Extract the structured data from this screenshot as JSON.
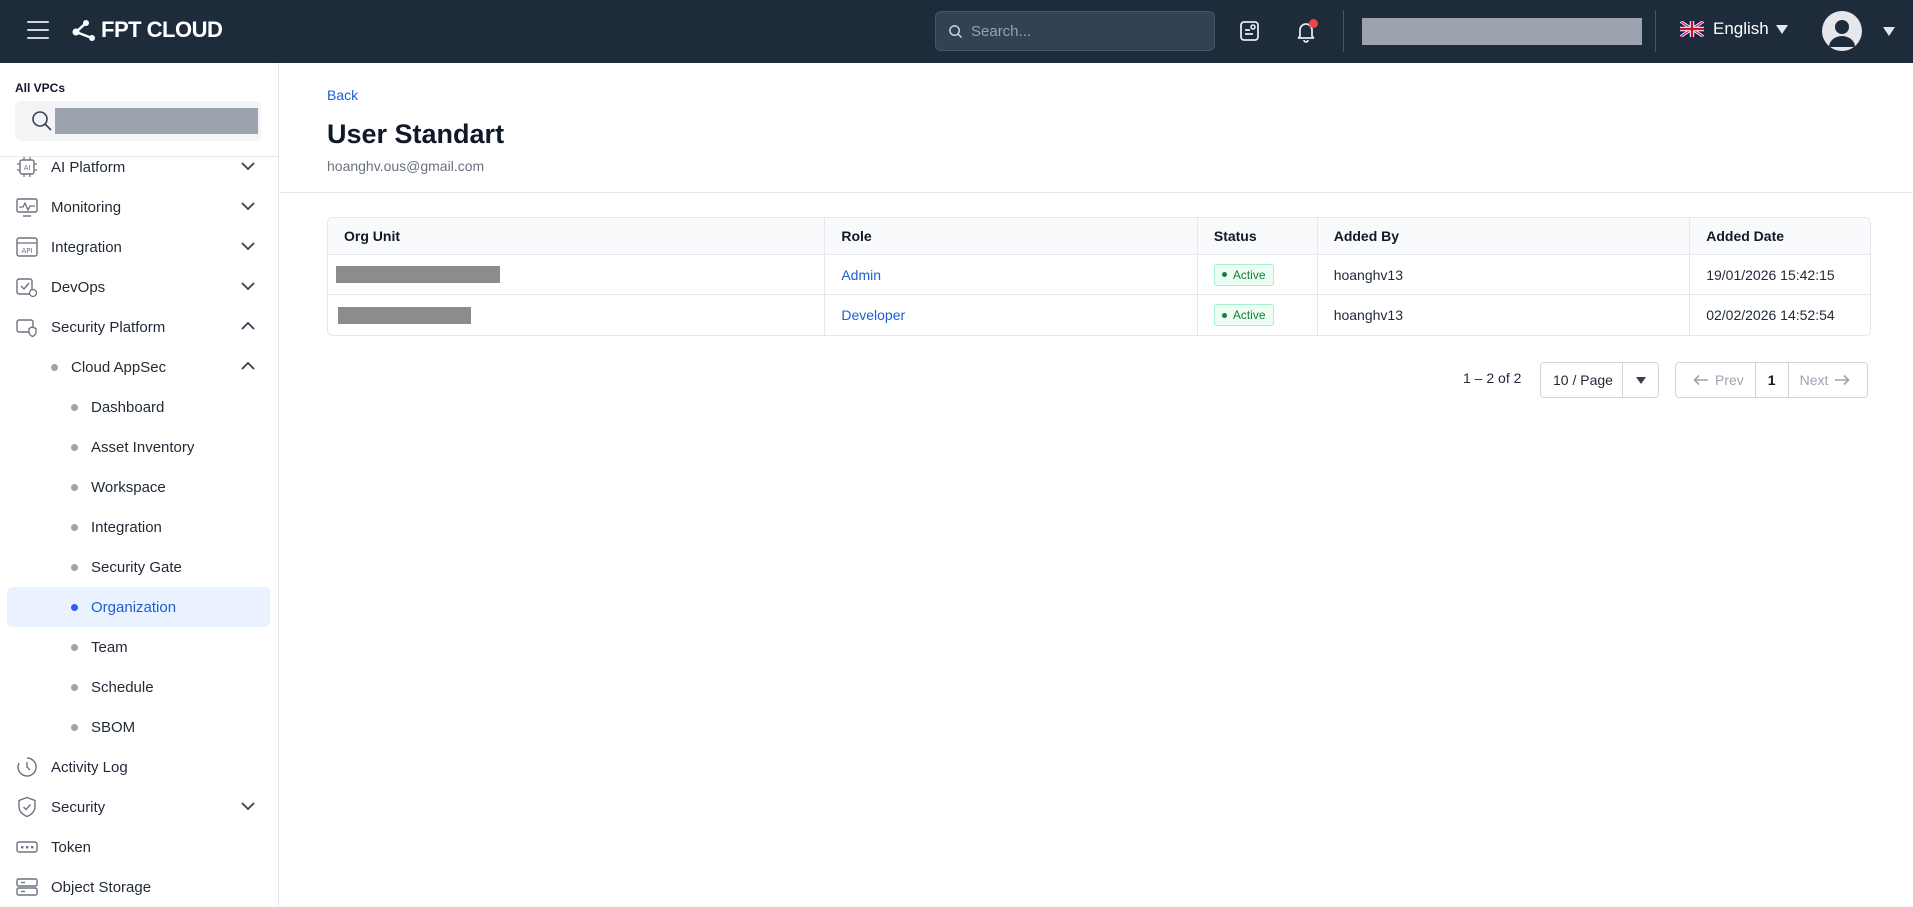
{
  "header": {
    "brand": "FPT CLOUD",
    "search_placeholder": "Search...",
    "language": "English",
    "icons": [
      "menu-icon",
      "fpt-logo",
      "search-icon",
      "tasks-icon",
      "bell-icon",
      "uk-flag-icon",
      "user-avatar-icon",
      "caret-down-icon"
    ]
  },
  "sidebar": {
    "vpc_label": "All VPCs",
    "items": [
      {
        "label": "AI Platform",
        "icon": "ai-chip-icon",
        "expandable": true,
        "expanded": false
      },
      {
        "label": "Monitoring",
        "icon": "monitor-icon",
        "expandable": true,
        "expanded": false
      },
      {
        "label": "Integration",
        "icon": "api-icon",
        "expandable": true,
        "expanded": false
      },
      {
        "label": "DevOps",
        "icon": "devops-icon",
        "expandable": true,
        "expanded": false
      },
      {
        "label": "Security Platform",
        "icon": "security-platform-icon",
        "expandable": true,
        "expanded": true
      },
      {
        "label": "Cloud AppSec",
        "level": 2,
        "expandable": true,
        "expanded": true
      },
      {
        "label": "Dashboard",
        "level": 3
      },
      {
        "label": "Asset Inventory",
        "level": 3
      },
      {
        "label": "Workspace",
        "level": 3
      },
      {
        "label": "Integration",
        "level": 3
      },
      {
        "label": "Security Gate",
        "level": 3
      },
      {
        "label": "Organization",
        "level": 3,
        "active": true
      },
      {
        "label": "Team",
        "level": 3
      },
      {
        "label": "Schedule",
        "level": 3
      },
      {
        "label": "SBOM",
        "level": 3
      },
      {
        "label": "Activity Log",
        "icon": "clock-icon"
      },
      {
        "label": "Security",
        "icon": "shield-icon",
        "expandable": true,
        "expanded": false
      },
      {
        "label": "Token",
        "icon": "token-icon"
      },
      {
        "label": "Object Storage",
        "icon": "storage-icon"
      }
    ]
  },
  "main": {
    "back_label": "Back",
    "title": "User Standart",
    "email": "hoanghv.ous@gmail.com",
    "table": {
      "columns": [
        "Org Unit",
        "Role",
        "Status",
        "Added By",
        "Added Date"
      ],
      "rows": [
        {
          "org_unit": "",
          "role": "Admin",
          "status": "Active",
          "added_by": "hoanghv13",
          "added_date": "19/01/2026 15:42:15"
        },
        {
          "org_unit": "",
          "role": "Developer",
          "status": "Active",
          "added_by": "hoanghv13",
          "added_date": "02/02/2026 14:52:54"
        }
      ]
    },
    "pagination": {
      "total_text": "1 – 2 of 2",
      "page_size": "10 / Page",
      "prev_label": "Prev",
      "current_page": "1",
      "next_label": "Next"
    }
  },
  "colors": {
    "header_bg": "#1e2b3a",
    "link": "#1d5fd1",
    "active_bg": "#eaf2ff",
    "status_active": "#15803d",
    "notification_dot": "#ef4444"
  }
}
